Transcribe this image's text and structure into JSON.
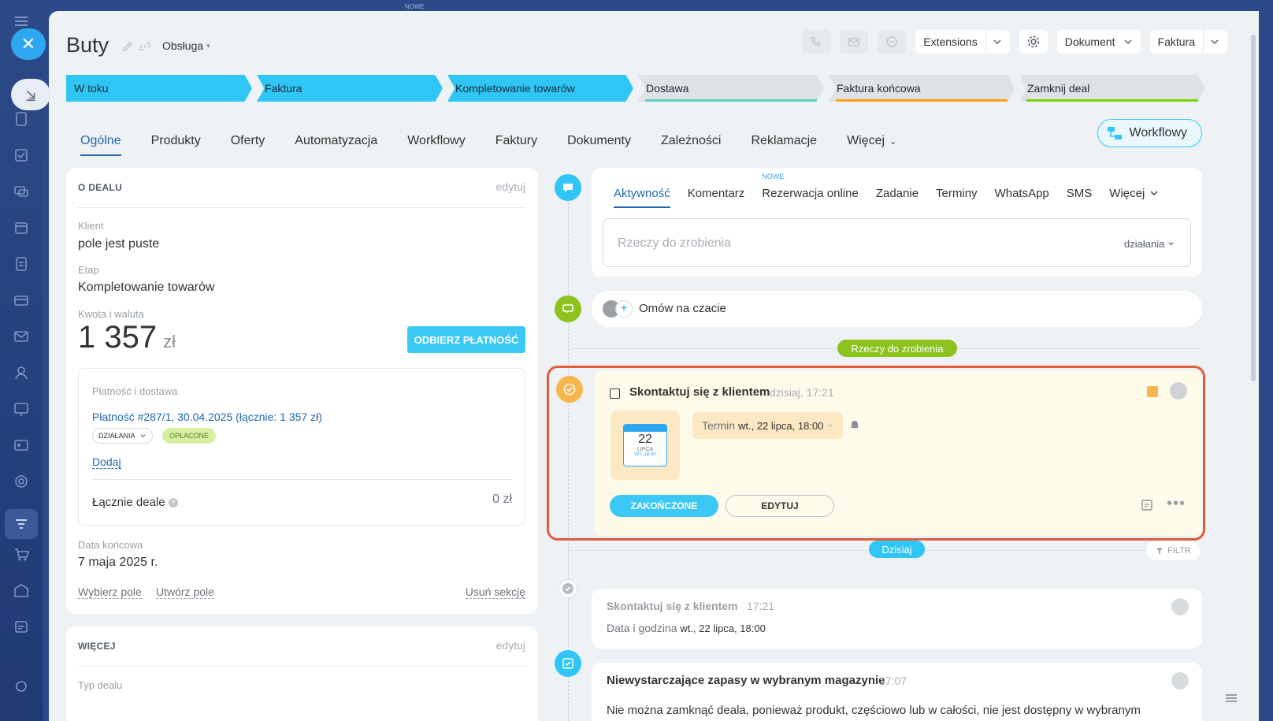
{
  "topbar": {
    "nowe_label": "NOWE"
  },
  "header": {
    "title": "Buty",
    "category": "Obsługa",
    "extensions": "Extensions",
    "dokument": "Dokument",
    "faktura": "Faktura"
  },
  "stages": [
    {
      "label": "W toku",
      "state": "active",
      "line_color": ""
    },
    {
      "label": "Faktura",
      "state": "active",
      "line_color": ""
    },
    {
      "label": "Kompletowanie towarów",
      "state": "active",
      "line_color": ""
    },
    {
      "label": "Dostawa",
      "state": "inactive",
      "line_color": "#58d5c6"
    },
    {
      "label": "Faktura końcowa",
      "state": "inactive",
      "line_color": "#ffa21a"
    },
    {
      "label": "Zamknij deal",
      "state": "inactive",
      "line_color": "#7bd500"
    }
  ],
  "tabs": [
    "Ogólne",
    "Produkty",
    "Oferty",
    "Automatyzacja",
    "Workflowy",
    "Faktury",
    "Dokumenty",
    "Zależności",
    "Reklamacje",
    "Więcej"
  ],
  "workflow_button": "Workflowy",
  "about": {
    "section_title": "O DEALU",
    "edit": "edytuj",
    "client_label": "Klient",
    "client_value": "pole jest puste",
    "stage_label": "Etap",
    "stage_value": "Kompletowanie towarów",
    "amount_label": "Kwota i waluta",
    "amount_value": "1 357",
    "amount_currency": "zł",
    "pay_button": "ODBIERZ PŁATNOŚĆ",
    "payment_label": "Płatność i dostawa",
    "payment_link": "Płatność #287/1, 30.04.2025 (łącznie: 1 357 zł)",
    "actions_label": "DZIAŁANIA",
    "paid_badge": "OPŁACONE",
    "add_link": "Dodaj",
    "total_label": "Łącznie deale",
    "total_value": "0 zł",
    "end_date_label": "Data końcowa",
    "end_date_value": "7 maja 2025 r.",
    "select_field": "Wybierz pole",
    "create_field": "Utwórz pole",
    "delete_section": "Usuń sekcję"
  },
  "more": {
    "section_title": "WIĘCEJ",
    "edit": "edytuj",
    "deal_type_label": "Typ dealu"
  },
  "activity": {
    "tabs": [
      "Aktywność",
      "Komentarz",
      "Rezerwacja online",
      "Zadanie",
      "Terminy",
      "WhatsApp",
      "SMS",
      "Więcej"
    ],
    "new_badge": "NOWE",
    "placeholder": "Rzeczy do zrobienia",
    "actions_dropdown": "działania"
  },
  "chat": {
    "text": "Omów na czacie"
  },
  "todo_pill": "Rzeczy do zrobienia",
  "todo": {
    "title": "Skontaktuj się z klientem",
    "time": "dzisiaj, 17:21",
    "cal_day": "22",
    "cal_month": "LIPCA",
    "cal_weekday": "WT.,18:00",
    "term_label": "Termin",
    "term_value": "wt., 22 lipca, 18:00",
    "done_button": "ZAKOŃCZONE",
    "edit_button": "EDYTUJ"
  },
  "today_pill": "Dzisiaj",
  "filter": "FILTR",
  "event1": {
    "title": "Skontaktuj się z klientem",
    "time": "17:21",
    "detail_label": "Data i godzina",
    "detail_value": "wt., 22 lipca, 18:00"
  },
  "event2": {
    "title": "Niewystarczające zapasy w wybranym magazynie",
    "time": "17:07",
    "text": "Nie można zamknąć deala, ponieważ produkt, częściowo lub w całości, nie jest dostępny w wybranym"
  },
  "colors": {
    "accent": "#2fc6f6",
    "link": "#2067b0",
    "highlight_border": "#e25c3c",
    "green_pill": "#8dc21f",
    "today_pill": "#2fc6f6"
  }
}
